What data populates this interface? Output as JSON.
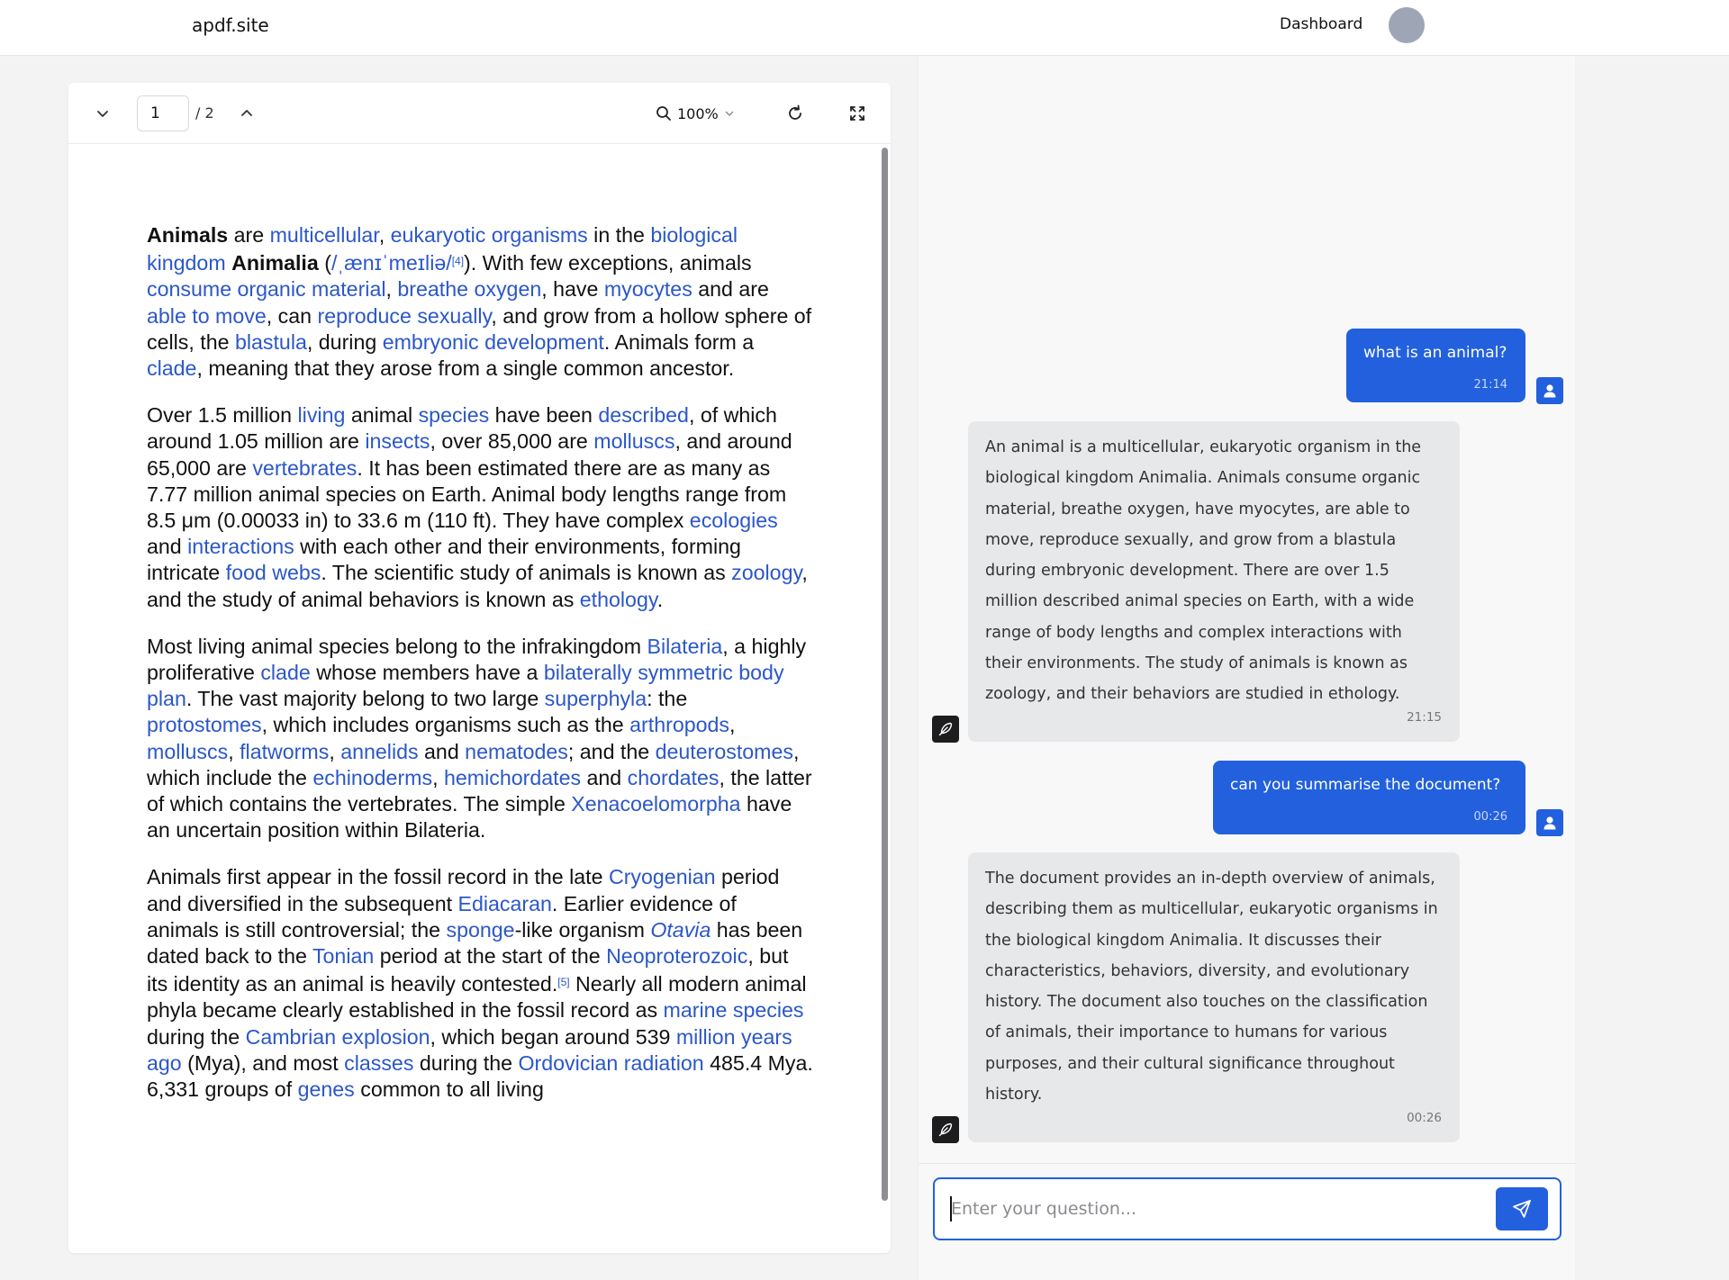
{
  "header": {
    "brand": "apdf.site",
    "dashboard_link": "Dashboard"
  },
  "viewer": {
    "current_page": "1",
    "total_pages_label": "/ 2",
    "zoom_label": "100%"
  },
  "document": {
    "paragraphs": [
      [
        {
          "t": "Animals",
          "b": true
        },
        {
          "t": " are "
        },
        {
          "t": "multicellular",
          "l": true
        },
        {
          "t": ", "
        },
        {
          "t": "eukaryotic organisms",
          "l": true
        },
        {
          "t": " in the "
        },
        {
          "t": "biological kingdom",
          "l": true
        },
        {
          "t": " "
        },
        {
          "t": "Animalia",
          "b": true
        },
        {
          "t": " ("
        },
        {
          "t": "/ˌænɪˈmeɪliə/",
          "l": true
        },
        {
          "t": "[4]",
          "s": true
        },
        {
          "t": "). With few exceptions, animals "
        },
        {
          "t": "consume organic material",
          "l": true
        },
        {
          "t": ", "
        },
        {
          "t": "breathe oxygen",
          "l": true
        },
        {
          "t": ", have "
        },
        {
          "t": "myocytes",
          "l": true
        },
        {
          "t": " and are "
        },
        {
          "t": "able to move",
          "l": true
        },
        {
          "t": ", can "
        },
        {
          "t": "reproduce sexually",
          "l": true
        },
        {
          "t": ", and grow from a hollow sphere of cells, the "
        },
        {
          "t": "blastula",
          "l": true
        },
        {
          "t": ", during "
        },
        {
          "t": "embryonic development",
          "l": true
        },
        {
          "t": ". Animals form a "
        },
        {
          "t": "clade",
          "l": true
        },
        {
          "t": ", meaning that they arose from a single common ancestor."
        }
      ],
      [
        {
          "t": "Over 1.5 million "
        },
        {
          "t": "living",
          "l": true
        },
        {
          "t": " animal "
        },
        {
          "t": "species",
          "l": true
        },
        {
          "t": " have been "
        },
        {
          "t": "described",
          "l": true
        },
        {
          "t": ", of which around 1.05 million are "
        },
        {
          "t": "insects",
          "l": true
        },
        {
          "t": ", over 85,000 are "
        },
        {
          "t": "molluscs",
          "l": true
        },
        {
          "t": ", and around 65,000 are "
        },
        {
          "t": "vertebrates",
          "l": true
        },
        {
          "t": ". It has been estimated there are as many as 7.77 million animal species on Earth. Animal body lengths range from 8.5 μm (0.00033 in) to 33.6 m (110 ft). They have complex "
        },
        {
          "t": "ecologies",
          "l": true
        },
        {
          "t": " and "
        },
        {
          "t": "interactions",
          "l": true
        },
        {
          "t": " with each other and their environments, forming intricate "
        },
        {
          "t": "food webs",
          "l": true
        },
        {
          "t": ". The scientific study of animals is known as "
        },
        {
          "t": "zoology",
          "l": true
        },
        {
          "t": ", and the study of animal behaviors is known as "
        },
        {
          "t": "ethology",
          "l": true
        },
        {
          "t": "."
        }
      ],
      [
        {
          "t": "Most living animal species belong to the infrakingdom "
        },
        {
          "t": "Bilateria",
          "l": true
        },
        {
          "t": ", a highly proliferative "
        },
        {
          "t": "clade",
          "l": true
        },
        {
          "t": " whose members have a "
        },
        {
          "t": "bilaterally symmetric body plan",
          "l": true
        },
        {
          "t": ". The vast majority belong to two large "
        },
        {
          "t": "superphyla",
          "l": true
        },
        {
          "t": ": the "
        },
        {
          "t": "protostomes",
          "l": true
        },
        {
          "t": ", which includes organisms such as the "
        },
        {
          "t": "arthropods",
          "l": true
        },
        {
          "t": ", "
        },
        {
          "t": "molluscs",
          "l": true
        },
        {
          "t": ", "
        },
        {
          "t": "flatworms",
          "l": true
        },
        {
          "t": ", "
        },
        {
          "t": "annelids",
          "l": true
        },
        {
          "t": " and "
        },
        {
          "t": "nematodes",
          "l": true
        },
        {
          "t": "; and the "
        },
        {
          "t": "deuterostomes",
          "l": true
        },
        {
          "t": ", which include the "
        },
        {
          "t": "echinoderms",
          "l": true
        },
        {
          "t": ", "
        },
        {
          "t": "hemichordates",
          "l": true
        },
        {
          "t": " and "
        },
        {
          "t": "chordates",
          "l": true
        },
        {
          "t": ", the latter of which contains the vertebrates. The simple "
        },
        {
          "t": "Xenacoelomorpha",
          "l": true
        },
        {
          "t": " have an uncertain position within Bilateria."
        }
      ],
      [
        {
          "t": "Animals first appear in the fossil record in the late "
        },
        {
          "t": "Cryogenian",
          "l": true
        },
        {
          "t": " period and diversified in the subsequent "
        },
        {
          "t": "Ediacaran",
          "l": true
        },
        {
          "t": ". Earlier evidence of animals is still controversial; the "
        },
        {
          "t": "sponge",
          "l": true
        },
        {
          "t": "-like organism "
        },
        {
          "t": "Otavia",
          "l": true,
          "i": true
        },
        {
          "t": " has been dated back to the "
        },
        {
          "t": "Tonian",
          "l": true
        },
        {
          "t": " period at the start of the "
        },
        {
          "t": "Neoproterozoic",
          "l": true
        },
        {
          "t": ", but its identity as an animal is heavily contested."
        },
        {
          "t": "[5]",
          "s": true
        },
        {
          "t": " Nearly all modern animal phyla became clearly established in the fossil record as "
        },
        {
          "t": "marine species",
          "l": true
        },
        {
          "t": " during the "
        },
        {
          "t": "Cambrian explosion",
          "l": true
        },
        {
          "t": ", which began around 539 "
        },
        {
          "t": "million years ago",
          "l": true
        },
        {
          "t": " (Mya), and most "
        },
        {
          "t": "classes",
          "l": true
        },
        {
          "t": " during the "
        },
        {
          "t": "Ordovician radiation",
          "l": true
        },
        {
          "t": " 485.4 Mya. 6,331 groups of "
        },
        {
          "t": "genes",
          "l": true
        },
        {
          "t": " common to all living"
        }
      ]
    ]
  },
  "chat": {
    "messages": [
      {
        "role": "user",
        "text": "what is an animal?",
        "time": "21:14"
      },
      {
        "role": "assistant",
        "text": "An animal is a multicellular, eukaryotic organism in the biological kingdom Animalia. Animals consume organic material, breathe oxygen, have myocytes, are able to move, reproduce sexually, and grow from a blastula during embryonic development. There are over 1.5 million described animal species on Earth, with a wide range of body lengths and complex interactions with their environments. The study of animals is known as zoology, and their behaviors are studied in ethology.",
        "time": "21:15"
      },
      {
        "role": "user",
        "text": "can you summarise the document?",
        "time": "00:26"
      },
      {
        "role": "assistant",
        "text": "The document provides an in-depth overview of animals, describing them as multicellular, eukaryotic organisms in the biological kingdom Animalia. It discusses their characteristics, behaviors, diversity, and evolutionary history. The document also touches on the classification of animals, their importance to humans for various purposes, and their cultural significance throughout history.",
        "time": "00:26"
      }
    ],
    "input_placeholder": "Enter your question..."
  },
  "colors": {
    "accent": "#2260de",
    "link": "#2b57c8",
    "bot_bubble": "#e7e8ea"
  },
  "icons": {
    "prev_page": "chevron-down-icon",
    "next_page": "chevron-up-icon",
    "zoom": "search-icon",
    "rotate": "rotate-icon",
    "fullscreen": "fullscreen-icon",
    "user": "user-icon",
    "assistant": "feather-icon",
    "send": "send-icon"
  }
}
